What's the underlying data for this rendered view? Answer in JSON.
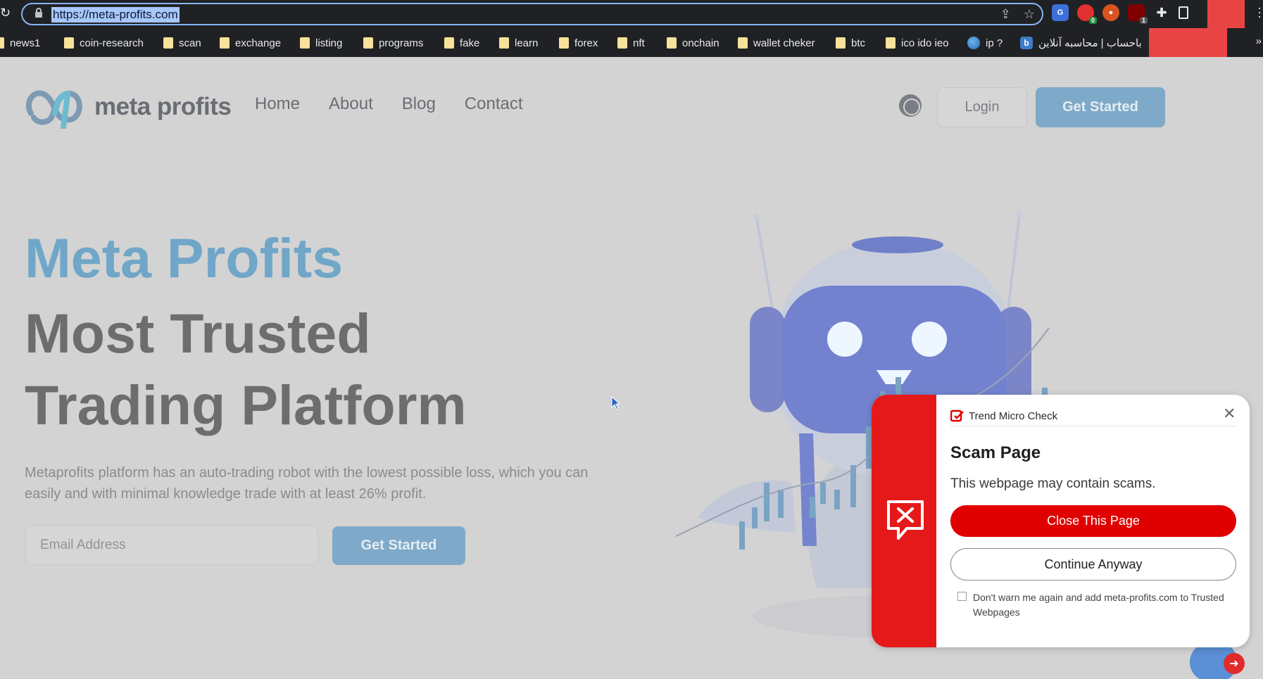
{
  "browser": {
    "url": "https://meta-profits.com",
    "icons": [
      "reload-icon",
      "lock-icon",
      "share-icon",
      "star-icon",
      "google-translate-icon",
      "extension-icon",
      "puzzle-icon",
      "window-icon",
      "menu-icon"
    ],
    "extension_badges": [
      "0",
      "1"
    ],
    "bookmarks": [
      {
        "label": "news1",
        "icon": "folder"
      },
      {
        "label": "coin-research",
        "icon": "folder"
      },
      {
        "label": "scan",
        "icon": "folder"
      },
      {
        "label": "exchange",
        "icon": "folder"
      },
      {
        "label": "listing",
        "icon": "folder"
      },
      {
        "label": "programs",
        "icon": "folder"
      },
      {
        "label": "fake",
        "icon": "folder"
      },
      {
        "label": "learn",
        "icon": "folder"
      },
      {
        "label": "forex",
        "icon": "folder"
      },
      {
        "label": "nft",
        "icon": "folder"
      },
      {
        "label": "onchain",
        "icon": "folder"
      },
      {
        "label": "wallet cheker",
        "icon": "folder"
      },
      {
        "label": "btc",
        "icon": "folder"
      },
      {
        "label": "ico ido ieo",
        "icon": "folder"
      },
      {
        "label": "ip ?",
        "icon": "globe"
      },
      {
        "label": "باحساب | محاسبه آنلاین",
        "icon": "b-icon"
      }
    ],
    "bookmarks_overflow": "»"
  },
  "site": {
    "logo_text": "meta profits",
    "nav": [
      "Home",
      "About",
      "Blog",
      "Contact"
    ],
    "login_label": "Login",
    "get_started_label": "Get Started",
    "hero_title": "Meta Profits",
    "hero_line1": "Most Trusted",
    "hero_line2": "Trading Platform",
    "hero_description": "Metaprofits platform has an auto-trading robot with the lowest possible loss, which you can easily and with minimal knowledge trade with at least 26% profit.",
    "email_placeholder": "Email Address",
    "hero_button": "Get Started"
  },
  "popup": {
    "brand": "Trend Micro Check",
    "title": "Scam Page",
    "message": "This webpage may contain scams.",
    "primary_button": "Close This Page",
    "secondary_button": "Continue Anyway",
    "checkbox_label": "Don't warn me again and add meta-profits.com to Trusted Webpages",
    "checkbox_checked": false,
    "accent_color": "#e5191a"
  }
}
